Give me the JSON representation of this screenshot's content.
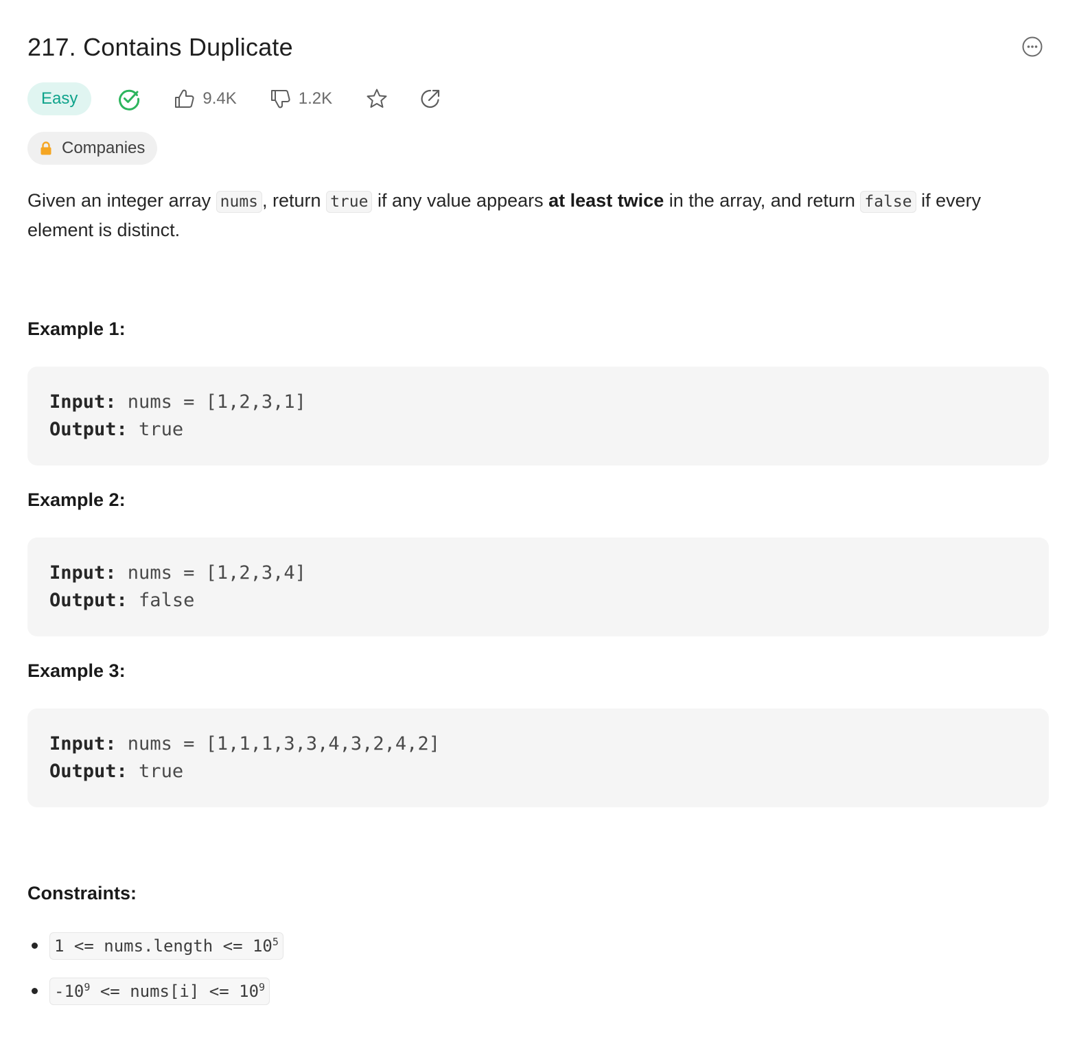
{
  "problem": {
    "title": "217. Contains Duplicate",
    "difficulty": "Easy",
    "likes": "9.4K",
    "dislikes": "1.2K",
    "companies_label": "Companies"
  },
  "description": {
    "t1": "Given an integer array ",
    "c1": "nums",
    "t2": ", return ",
    "c2": "true",
    "t3": " if any value appears ",
    "b1": "at least twice",
    "t4": " in the array, and return ",
    "c3": "false",
    "t5": " if every element is distinct."
  },
  "examples": [
    {
      "title": "Example 1:",
      "input_label": "Input:",
      "input": " nums = [1,2,3,1]",
      "output_label": "Output:",
      "output": " true"
    },
    {
      "title": "Example 2:",
      "input_label": "Input:",
      "input": " nums = [1,2,3,4]",
      "output_label": "Output:",
      "output": " false"
    },
    {
      "title": "Example 3:",
      "input_label": "Input:",
      "input": " nums = [1,1,1,3,3,4,3,2,4,2]",
      "output_label": "Output:",
      "output": " true"
    }
  ],
  "constraints": {
    "title": "Constraints:",
    "c1_pre": "1 <= nums.length <= 10",
    "c1_exp": "5",
    "c2_pre": "-10",
    "c2_exp1": "9",
    "c2_mid": " <= nums[i] <= 10",
    "c2_exp2": "9"
  },
  "colors": {
    "easy_text": "#0fa38b",
    "easy_bg": "#e0f5f1",
    "solved_green": "#2db55d",
    "lock_orange": "#f5a623"
  },
  "icons": [
    "more-icon",
    "solved-check-icon",
    "thumbs-up-icon",
    "thumbs-down-icon",
    "star-icon",
    "share-icon",
    "lock-icon"
  ]
}
